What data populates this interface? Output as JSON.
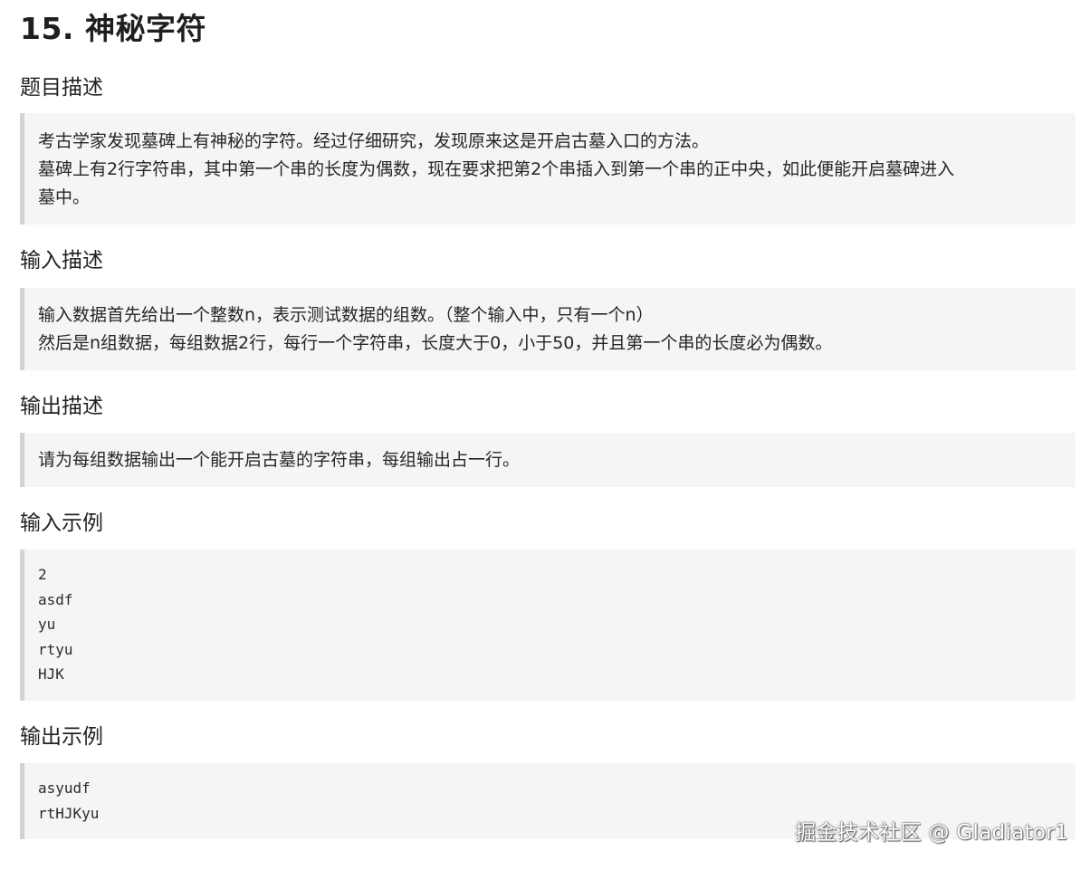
{
  "title": "15. 神秘字符",
  "sections": {
    "description": {
      "heading": "题目描述",
      "lines": [
        "考古学家发现墓碑上有神秘的字符。经过仔细研究，发现原来这是开启古墓入口的方法。",
        "墓碑上有2行字符串，其中第一个串的长度为偶数，现在要求把第2个串插入到第一个串的正中央，如此便能开启墓碑进入",
        "墓中。"
      ]
    },
    "input": {
      "heading": "输入描述",
      "lines": [
        "输入数据首先给出一个整数n，表示测试数据的组数。（整个输入中，只有一个n）",
        "然后是n组数据，每组数据2行，每行一个字符串，长度大于0，小于50，并且第一个串的长度必为偶数。"
      ]
    },
    "output": {
      "heading": "输出描述",
      "lines": [
        "请为每组数据输出一个能开启古墓的字符串，每组输出占一行。"
      ]
    },
    "sample_input": {
      "heading": "输入示例",
      "lines": [
        "2",
        "asdf",
        "yu",
        "rtyu",
        "HJK"
      ]
    },
    "sample_output": {
      "heading": "输出示例",
      "lines": [
        "asyudf",
        "rtHJKyu"
      ]
    }
  },
  "watermark": "掘金技术社区 @ Gladiator1"
}
